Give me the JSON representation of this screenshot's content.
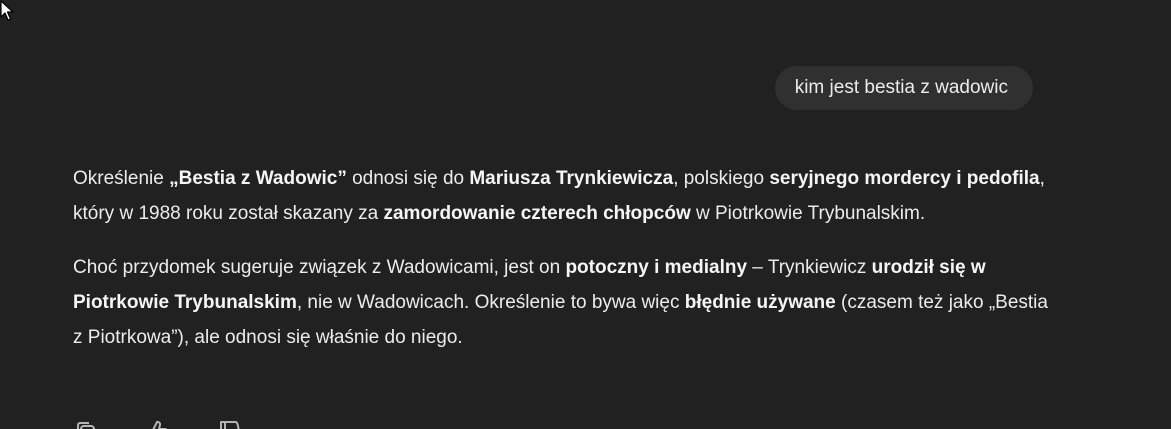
{
  "user_message": {
    "text": "kim jest bestia z wadowic"
  },
  "assistant_message": {
    "p1": {
      "t1": "Określenie ",
      "b1": "„Bestia z Wadowic”",
      "t2": " odnosi się do ",
      "b2": "Mariusza Trynkiewicza",
      "t3": ", polskiego ",
      "b3": "seryjnego mordercy i pedofila",
      "t4": ", który w 1988 roku został skazany za ",
      "b4": "zamordowanie czterech chłopców",
      "t5": " w Piotrkowie Trybunalskim."
    },
    "p2": {
      "t1": "Choć przydomek sugeruje związek z Wadowicami, jest on ",
      "b1": "potoczny i medialny",
      "t2": " – Trynkiewicz ",
      "b2": "urodził się w Piotrkowie Trybunalskim",
      "t3": ", nie w Wadowicach. Określenie to bywa więc ",
      "b3": "błędnie używane",
      "t4": " (czasem też jako „Bestia z Piotrkowa”), ale odnosi się właśnie do niego."
    }
  },
  "actions": {
    "icons": [
      "copy-icon",
      "thumbs-up-icon",
      "thumbs-down-icon"
    ]
  }
}
